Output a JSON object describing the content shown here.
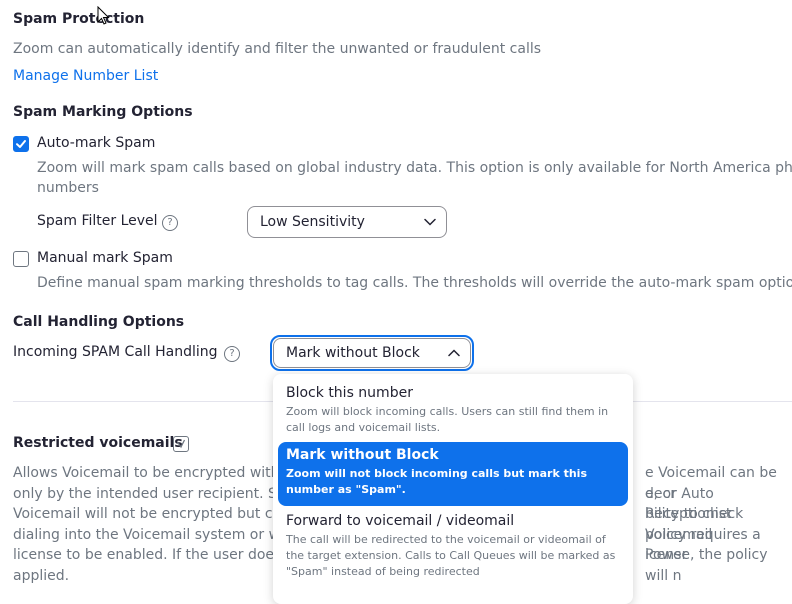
{
  "spam_protection": {
    "title": "Spam Protection",
    "description": "Zoom can automatically identify and filter the unwanted or fraudulent calls",
    "manage_link": "Manage Number List"
  },
  "marking": {
    "title": "Spam Marking Options",
    "auto_mark": {
      "label": "Auto-mark Spam",
      "checked": true,
      "desc_line1": "Zoom will mark spam calls based on global industry data. This option is only available for North America phone",
      "desc_line2": "numbers"
    },
    "filter_level": {
      "label": "Spam Filter Level",
      "help": "?",
      "value": "Low Sensitivity"
    },
    "manual_mark": {
      "label": "Manual mark Spam",
      "checked": false,
      "desc": "Define manual spam marking thresholds to tag calls. The thresholds will override the auto-mark spam option"
    }
  },
  "handling": {
    "title": "Call Handling Options",
    "incoming_label": "Incoming SPAM Call Handling",
    "help": "?",
    "selected": "Mark without Block",
    "options": [
      {
        "title": "Block this number",
        "desc": "Zoom will block incoming calls. Users can still find them in call logs and voicemail lists."
      },
      {
        "title": "Mark without Block",
        "desc": "Zoom will not block incoming calls but mark this number as \"Spam\"."
      },
      {
        "title": "Forward to voicemail / videomail",
        "desc": "The call will be redirected to the voicemail or videomail of the target extension. Calls to Call Queues will be marked as \"Spam\" instead of being redirected"
      }
    ]
  },
  "restricted": {
    "title": "Restricted voicemails",
    "lines": [
      {
        "left": "Allows Voicemail to be encrypted with",
        "right": "e Voicemail can be decr"
      },
      {
        "left": "only by the intended user recipient. Sh",
        "right": "e, or Auto Receptionist"
      },
      {
        "left": "Voicemail will not be encrypted but ca",
        "right": "bility to check Voicemail"
      },
      {
        "left": "dialing into the Voicemail system or we",
        "right": "policy requires a Power"
      },
      {
        "left": "license to be enabled. If the user does",
        "right": "icense, the policy will n"
      },
      {
        "left": "applied.",
        "right": ""
      }
    ]
  },
  "colors": {
    "accent": "#0e71eb",
    "text": "#232333",
    "muted": "#6e7680"
  }
}
